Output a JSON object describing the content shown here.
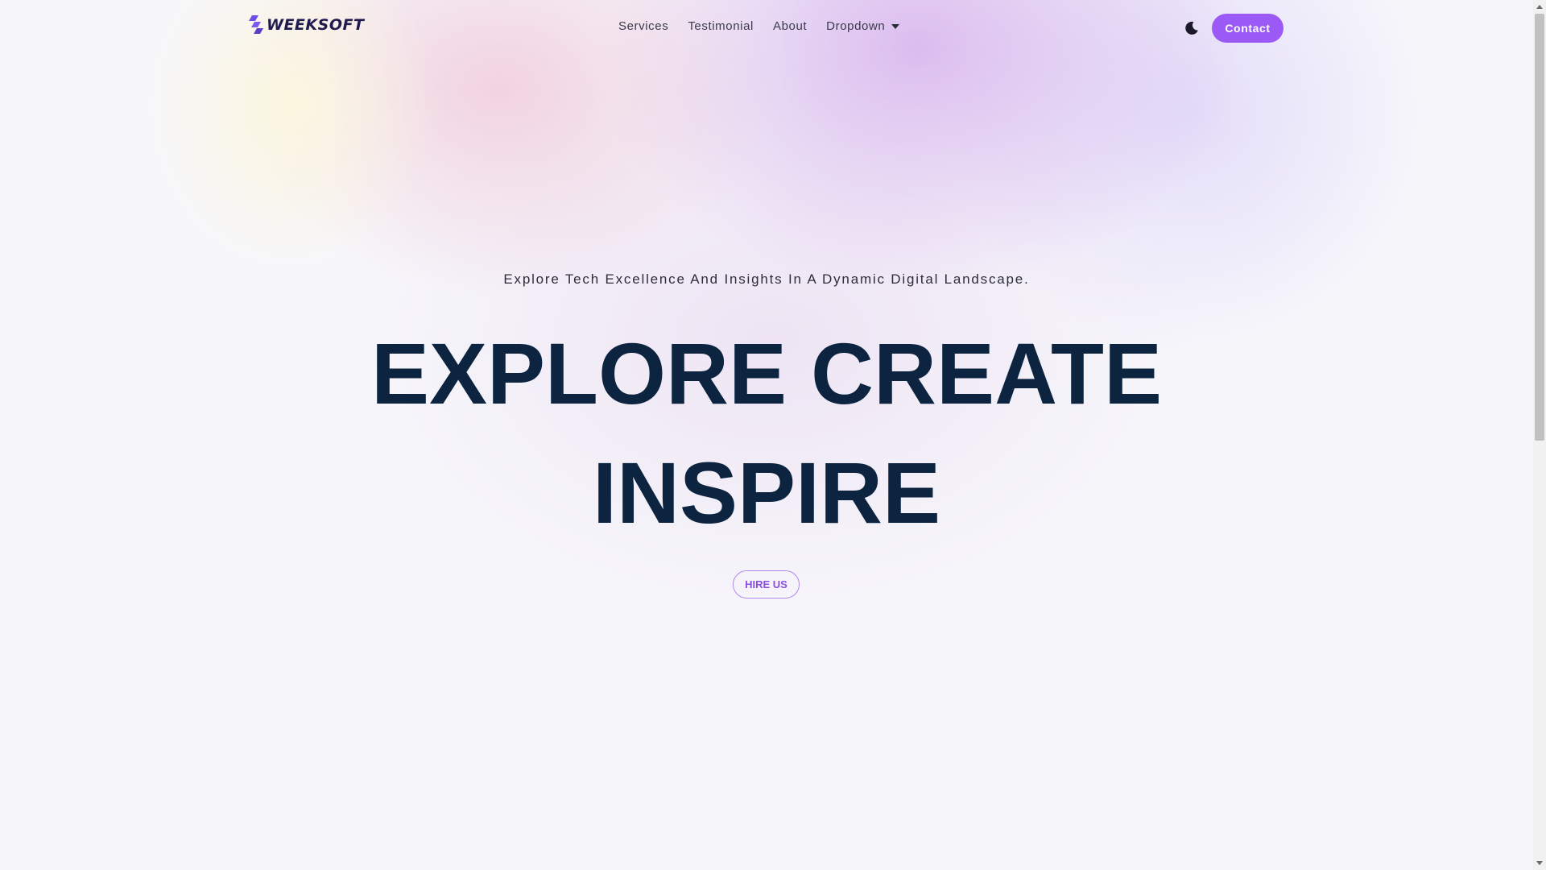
{
  "brand": {
    "name": "WEEKSOFT",
    "logo_color": "#6c4ee0"
  },
  "nav": {
    "items": [
      {
        "label": "Services"
      },
      {
        "label": "Testimonial"
      },
      {
        "label": "About"
      },
      {
        "label": "Dropdown",
        "icon": "caret-down-icon"
      }
    ],
    "theme_toggle_icon": "moon-icon",
    "contact_label": "Contact"
  },
  "hero": {
    "subtitle": "Explore Tech Excellence And Insights In A Dynamic Digital Landscape.",
    "title_line1": "EXPLORE CREATE",
    "title_line2": "INSPIRE",
    "cta_label": "HIRE US"
  },
  "colors": {
    "accent": "#9b59f6",
    "heading": "#0c2440",
    "background": "#f7f7fb"
  }
}
